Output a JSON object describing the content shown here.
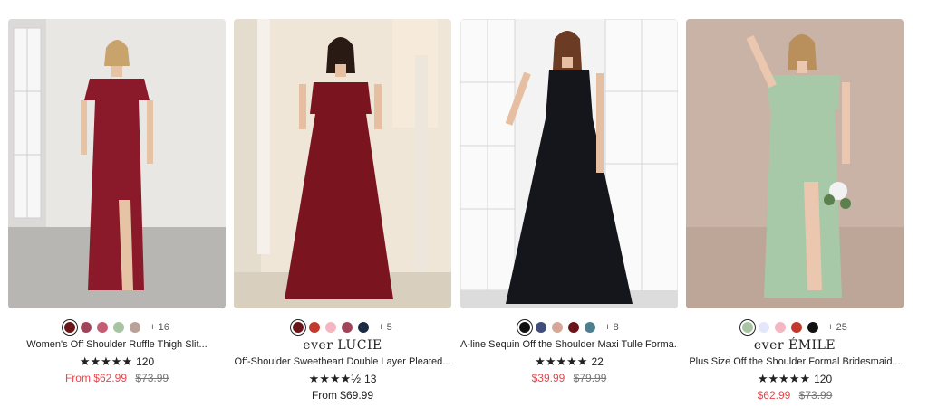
{
  "products": [
    {
      "brand": "",
      "title": "Women's Off Shoulder Ruffle Thigh Slit...",
      "stars": "★★★★★",
      "reviews": "120",
      "price_now": "From $62.99",
      "price_was": "$73.99",
      "more_colors": "+ 16",
      "swatches": [
        "#6b1519",
        "#a0445a",
        "#c65b74",
        "#a8c4a2",
        "#b9a19a"
      ],
      "dress_color": "#8a1a2a",
      "bg_color": "#e9e7e4"
    },
    {
      "brand": "ever LUCIE",
      "title": "Off-Shoulder Sweetheart Double Layer Pleated...",
      "stars": "★★★★½",
      "reviews": "13",
      "price_now": "From $69.99",
      "price_was": "",
      "more_colors": "+ 5",
      "swatches": [
        "#6b1519",
        "#c0392b",
        "#f4b6c2",
        "#a0445a",
        "#1c2a44"
      ],
      "dress_color": "#7a1520",
      "bg_color": "#efe6d8"
    },
    {
      "brand": "",
      "title": "A-line Sequin Off the Shoulder Maxi Tulle Forma...",
      "stars": "★★★★★",
      "reviews": "22",
      "price_now": "$39.99",
      "price_was": "$79.99",
      "more_colors": "+ 8",
      "swatches": [
        "#111111",
        "#3f4f7a",
        "#d9a79a",
        "#6b1519",
        "#4d7f8f"
      ],
      "dress_color": "#14161c",
      "bg_color": "#f3f3f3"
    },
    {
      "brand": "ever ÉMILE",
      "title": "Plus Size Off the Shoulder Formal Bridesmaid...",
      "stars": "★★★★★",
      "reviews": "120",
      "price_now": "$62.99",
      "price_was": "$73.99",
      "more_colors": "+ 25",
      "swatches": [
        "#a8c4a2",
        "#e4e6fb",
        "#f4b6c2",
        "#c0392b",
        "#111111"
      ],
      "dress_color": "#a8c9a8",
      "bg_color": "#c9b2a6"
    }
  ]
}
